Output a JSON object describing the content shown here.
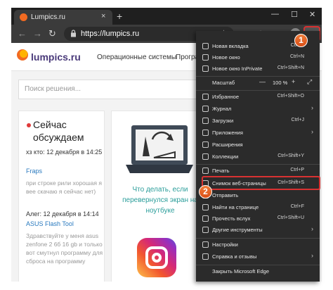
{
  "browser": {
    "tab_title": "Lumpics.ru",
    "tab_close": "×",
    "new_tab": "+",
    "url": "https://lumpics.ru",
    "window_controls": [
      "—",
      "☐",
      "✕"
    ],
    "more_icon": "···",
    "colors": {
      "frame": "#1f1f1f",
      "toolbar": "#3b3b3b",
      "highlight": "#d93232",
      "callout": "#e8632a"
    }
  },
  "site": {
    "logo": "lumpics.ru",
    "nav": [
      "Операционные системы",
      "Программ"
    ],
    "search_placeholder": "Поиск решения...",
    "live": {
      "title": "Сейчас обсуждаем",
      "items": [
        {
          "meta": "хз кто: 12 декабря в 14:25",
          "link": "Fraps",
          "text": "при строке рили хорошая я вее скачаю я сейчас нет)"
        },
        {
          "meta": "Алег: 12 декабря в 14:14",
          "link": "ASUS Flash Tool",
          "text": "Здравствуйте у меня asus zenfone 2 6б 16 gb и только вот смутнул программу для сброса на программу"
        }
      ]
    },
    "article_title": "Что делать, если перевернулся экран на ноутбуке"
  },
  "menu": {
    "items": [
      {
        "label": "Новая вкладка",
        "shortcut": "Ctrl+T",
        "icon": "new-tab-icon"
      },
      {
        "label": "Новое окно",
        "shortcut": "Ctrl+N",
        "icon": "new-window-icon"
      },
      {
        "label": "Новое окно InPrivate",
        "shortcut": "Ctrl+Shift+N",
        "icon": "inprivate-icon"
      },
      {
        "label": "Избранное",
        "shortcut": "Ctrl+Shift+O",
        "icon": "favorites-icon"
      },
      {
        "label": "Журнал",
        "shortcut": "",
        "icon": "history-icon",
        "submenu": true
      },
      {
        "label": "Загрузки",
        "shortcut": "Ctrl+J",
        "icon": "downloads-icon"
      },
      {
        "label": "Приложения",
        "shortcut": "",
        "icon": "apps-icon",
        "submenu": true
      },
      {
        "label": "Расширения",
        "shortcut": "",
        "icon": "extensions-icon"
      },
      {
        "label": "Коллекции",
        "shortcut": "Ctrl+Shift+Y",
        "icon": "collections-icon"
      },
      {
        "label": "Печать",
        "shortcut": "Ctrl+P",
        "icon": "print-icon"
      },
      {
        "label": "Снимок веб-страницы",
        "shortcut": "Ctrl+Shift+S",
        "icon": "web-capture-icon"
      },
      {
        "label": "Отправить",
        "shortcut": "",
        "icon": "share-icon"
      },
      {
        "label": "Найти на странице",
        "shortcut": "Ctrl+F",
        "icon": "find-icon"
      },
      {
        "label": "Прочесть вслух",
        "shortcut": "Ctrl+Shift+U",
        "icon": "read-aloud-icon"
      },
      {
        "label": "Другие инструменты",
        "shortcut": "",
        "icon": "more-tools-icon",
        "submenu": true
      },
      {
        "label": "Настройки",
        "shortcut": "",
        "icon": "settings-icon"
      },
      {
        "label": "Справка и отзывы",
        "shortcut": "",
        "icon": "help-icon",
        "submenu": true
      },
      {
        "label": "Закрыть Microsoft Edge",
        "shortcut": "",
        "icon": "close-icon"
      }
    ],
    "zoom": {
      "label": "Масштаб",
      "minus": "—",
      "value": "100 %",
      "plus": "+",
      "fullscreen": "⤢"
    },
    "submenu_arrow": "›"
  },
  "callouts": [
    "1",
    "2"
  ]
}
